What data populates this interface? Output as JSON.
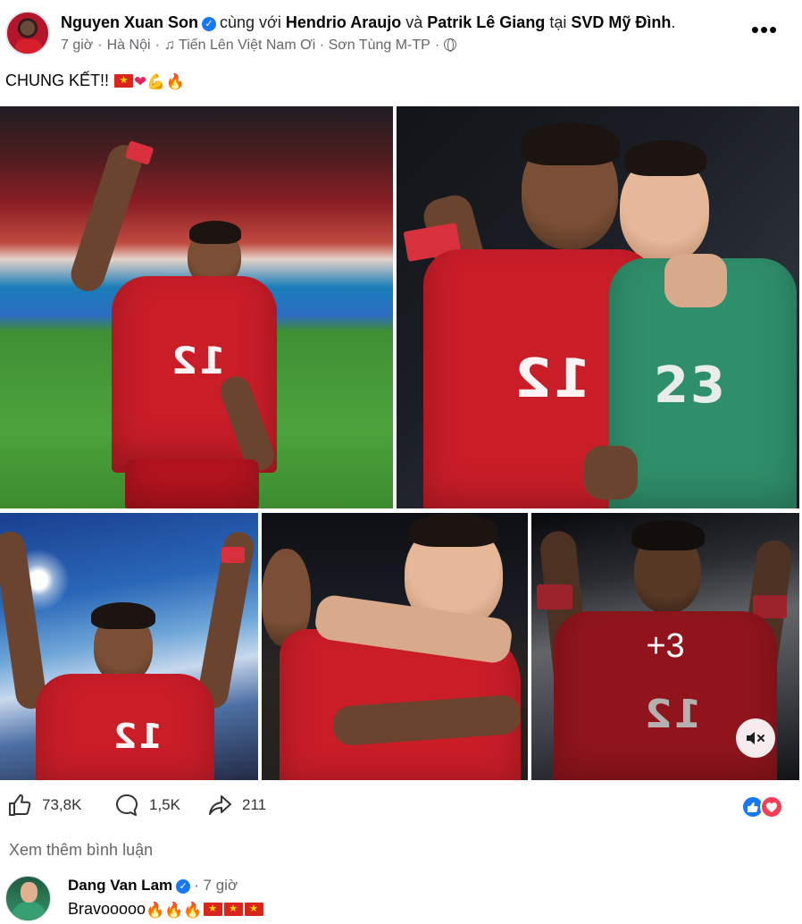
{
  "post": {
    "author": "Nguyen Xuan Son",
    "with_word": "cùng với",
    "tag_1": "Hendrio Araujo",
    "and_word": "và",
    "tag_2": "Patrik Lê Giang",
    "at_word": "tại",
    "location": "SVD Mỹ Đình",
    "location_suffix": ".",
    "time": "7 giờ",
    "city": "Hà Nội",
    "music": "Tiến Lên Việt Nam Ơi · Sơn Tùng M-TP",
    "privacy_icon": "globe-icon",
    "more_label": "•••",
    "caption_text": "CHUNG KẾT!!",
    "caption_emojis": [
      "flag-vn",
      "red-heart",
      "flexed-biceps",
      "fire"
    ]
  },
  "photos": {
    "numbers": {
      "p1": "12",
      "p2_player1": "12",
      "p2_player2": "23",
      "p3": "12",
      "p5": "12"
    },
    "extra_count": "+3",
    "mute_icon": "speaker-muted-icon"
  },
  "actions": {
    "likes": "73,8K",
    "comments": "1,5K",
    "shares": "211",
    "reaction_icons": [
      "like",
      "love"
    ]
  },
  "comments_section": {
    "more_comments_label": "Xem thêm bình luận",
    "items": [
      {
        "name": "Dang Van Lam",
        "time": "7 giờ",
        "text": "Bravooooo",
        "emojis": [
          "fire",
          "fire",
          "fire",
          "flag-vn",
          "flag-vn",
          "flag-vn"
        ]
      }
    ]
  },
  "colors": {
    "verified_blue": "#1877f2",
    "love_red": "#f33e58",
    "meta_gray": "#65676b"
  }
}
